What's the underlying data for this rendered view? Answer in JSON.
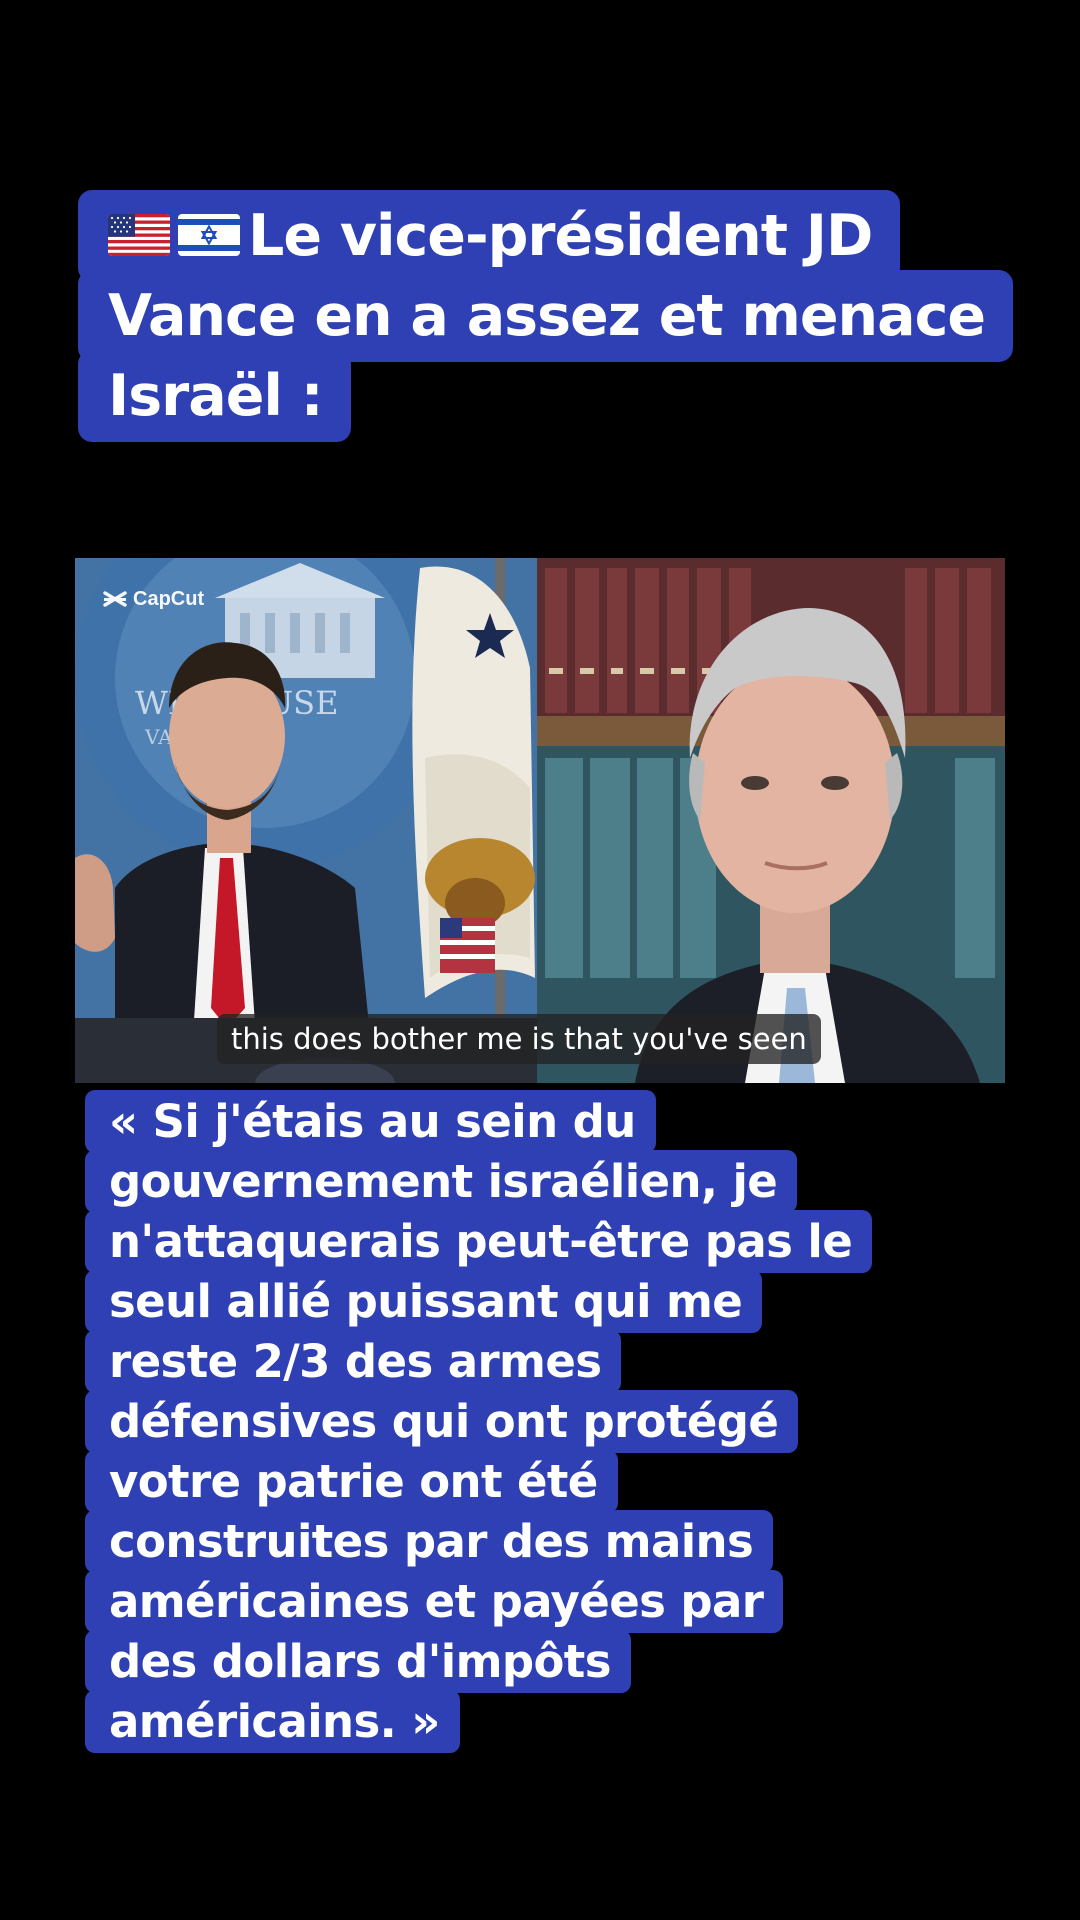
{
  "headline": {
    "flags": [
      "us-flag",
      "israel-flag"
    ],
    "lines": [
      "Le vice-président JD",
      "Vance en a assez et menace",
      "Israël :"
    ]
  },
  "video": {
    "watermark": "CapCut",
    "subtitle": "this does bother me is that you've seen"
  },
  "quote": {
    "lines": [
      "« Si j'étais au sein du",
      "gouvernement israélien, je",
      "n'attaquerais peut-être pas le",
      "seul allié puissant qui me",
      "reste 2/3 des armes",
      "défensives qui ont protégé",
      "votre patrie ont été",
      "construites par des mains",
      "américaines et payées par",
      "des dollars d'impôts",
      "américains. »"
    ]
  },
  "colors": {
    "caption_bg": "#2f40b5",
    "caption_text": "#ffffff",
    "page_bg": "#000000"
  }
}
